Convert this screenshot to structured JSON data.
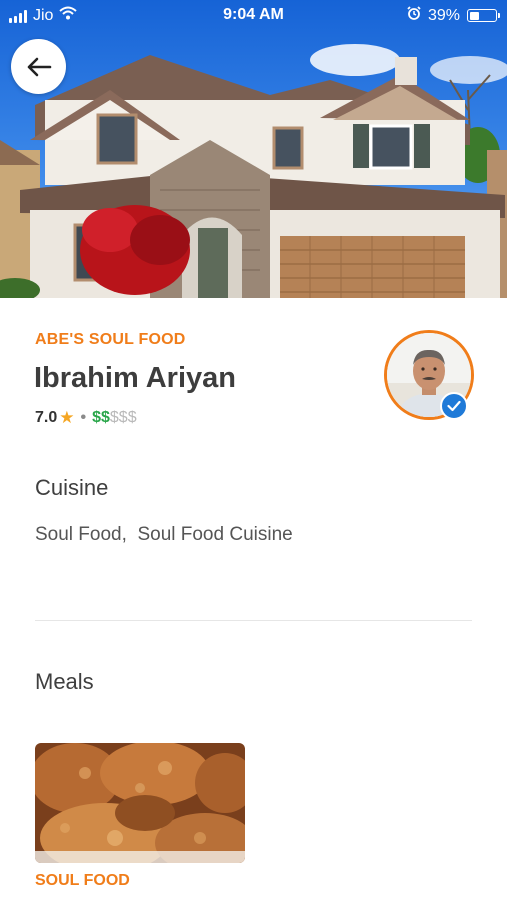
{
  "status_bar": {
    "carrier": "Jio",
    "time": "9:04 AM",
    "battery_percent": "39%",
    "battery_level": 0.39,
    "icons": [
      "signal-icon",
      "wifi-icon",
      "alarm-icon",
      "battery-icon"
    ]
  },
  "header": {
    "back_icon": "arrow-left-icon",
    "hero_image": "house-photo"
  },
  "kitchen": {
    "brand_name": "ABE'S SOUL FOOD",
    "chef_name": "Ibrahim Ariyan",
    "rating": "7.0",
    "rating_separator": "•",
    "price_active": "$$",
    "price_inactive": "$$$",
    "verified": true
  },
  "cuisine": {
    "title": "Cuisine",
    "text": "Soul Food,  Soul Food Cuisine"
  },
  "meals": {
    "title": "Meals",
    "items": [
      {
        "category": "SOUL FOOD",
        "image": "fried-chicken-photo"
      }
    ]
  },
  "colors": {
    "accent_orange": "#f07d1a",
    "price_green": "#2aa64a",
    "star_gold": "#f5a623",
    "verified_blue": "#1f7ad8"
  }
}
